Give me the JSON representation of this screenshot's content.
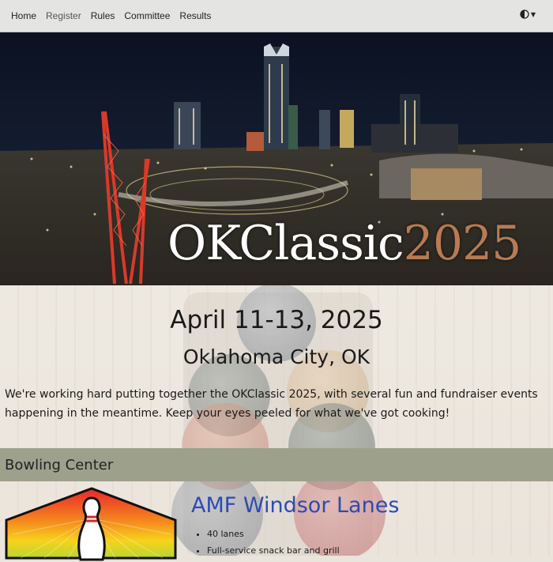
{
  "nav": {
    "links": [
      {
        "label": "Home"
      },
      {
        "label": "Register"
      },
      {
        "label": "Rules"
      },
      {
        "label": "Committee"
      },
      {
        "label": "Results"
      }
    ],
    "theme_icon": "contrast-half-circle-icon"
  },
  "hero": {
    "title_main": "OKClassic",
    "title_year": "2025",
    "image": "oklahoma-city-night-skyline"
  },
  "event": {
    "dates": "April 11-13, 2025",
    "location": "Oklahoma City, OK",
    "intro": "We're working hard putting together the OKClassic 2025, with several fun and fundraiser events happening in the meantime. Keep your eyes peeled for what we've got cooking!"
  },
  "bowling_center": {
    "section_title": "Bowling Center",
    "name": "AMF Windsor Lanes",
    "features": [
      "40 lanes",
      "Full-service snack bar and grill"
    ],
    "logo_icon": "bowling-pin-sunburst-logo"
  },
  "colors": {
    "nav_bg": "#e4e4e2",
    "section_bar": "#9da18c",
    "link_blue": "#2b4bb6",
    "year_copper": "#b77b54"
  }
}
